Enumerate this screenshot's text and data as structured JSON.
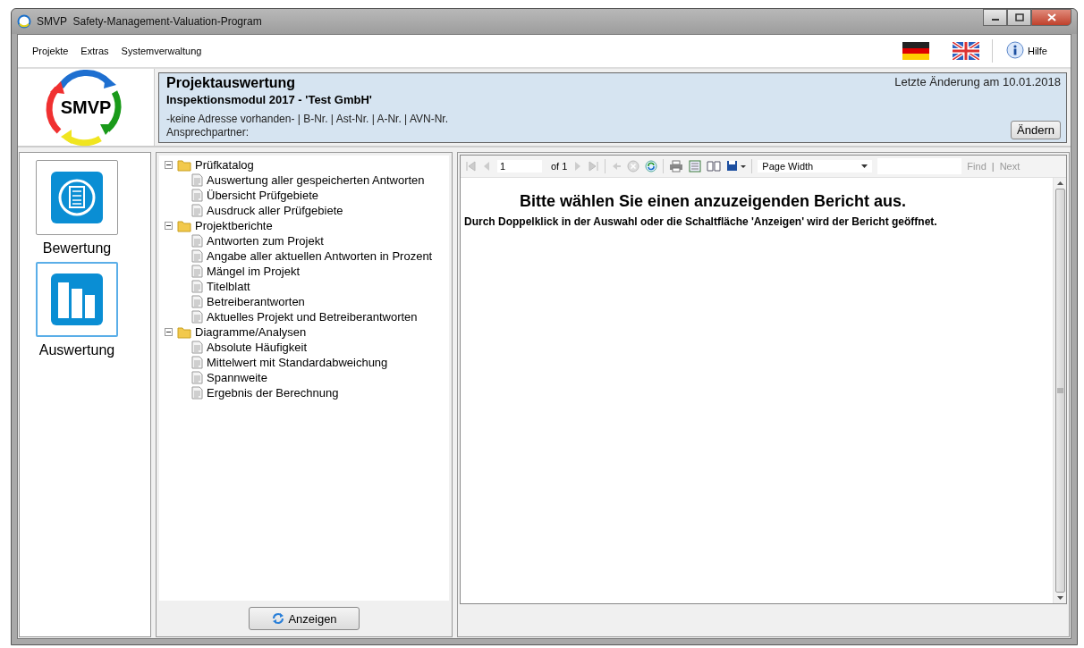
{
  "window": {
    "title": "SMVP  Safety-Management-Valuation-Program"
  },
  "menu": [
    "Projekte",
    "Extras",
    "Systemverwaltung"
  ],
  "help": {
    "label": "Hilfe"
  },
  "logo": {
    "text": "SMVP"
  },
  "header": {
    "title": "Projektauswertung",
    "subtitle": "Inspektionsmodul 2017 - 'Test GmbH'",
    "address": "-keine Adresse vorhanden- |  B-Nr.  |  Ast-Nr.  |  A-Nr.  |  AVN-Nr.",
    "contact": "Ansprechpartner:",
    "last_changed": "Letzte Änderung am 10.01.2018",
    "button": "Ändern"
  },
  "nav": [
    {
      "label": "Bewertung",
      "kind": "checklist",
      "selected": false
    },
    {
      "label": "Auswertung",
      "kind": "chart",
      "selected": true
    }
  ],
  "tree": [
    {
      "label": "Prüfkatalog",
      "expanded": true,
      "children": [
        {
          "label": "Auswertung aller gespeicherten Antworten"
        },
        {
          "label": "Übersicht Prüfgebiete"
        },
        {
          "label": "Ausdruck aller Prüfgebiete"
        }
      ]
    },
    {
      "label": "Projektberichte",
      "expanded": true,
      "children": [
        {
          "label": "Antworten zum Projekt"
        },
        {
          "label": "Angabe aller aktuellen Antworten in Prozent"
        },
        {
          "label": "Mängel im Projekt"
        },
        {
          "label": "Titelblatt"
        },
        {
          "label": "Betreiberantworten"
        },
        {
          "label": "Aktuelles Projekt und Betreiberantworten"
        }
      ]
    },
    {
      "label": "Diagramme/Analysen",
      "expanded": true,
      "children": [
        {
          "label": "Absolute Häufigkeit"
        },
        {
          "label": "Mittelwert mit Standardabweichung"
        },
        {
          "label": "Spannweite"
        },
        {
          "label": "Ergebnis der Berechnung"
        }
      ]
    }
  ],
  "show_button": "Anzeigen",
  "report": {
    "page": "1",
    "of": "of 1",
    "zoom": "Page Width",
    "find": "Find",
    "find_separator": "|",
    "next": "Next",
    "message_title": "Bitte wählen Sie einen anzuzeigenden Bericht aus.",
    "message_text": "Durch Doppelklick in der Auswahl oder die Schaltfläche 'Anzeigen' wird der Bericht geöffnet."
  }
}
